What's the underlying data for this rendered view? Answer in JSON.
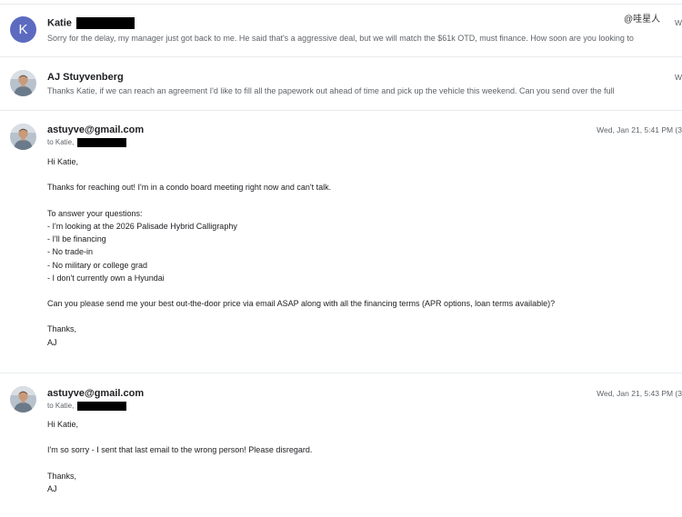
{
  "watermark": "@哇星人",
  "messages": [
    {
      "sender": "Katie",
      "avatar_letter": "K",
      "snippet": "Sorry for the delay, my manager just got back to me. He said that's a aggressive deal, but we will match the $61k OTD, must finance. How soon are you looking to",
      "date": "W"
    },
    {
      "sender": "AJ Stuyvenberg",
      "snippet": "Thanks Katie, if we can reach an agreement I'd like to fill all the papework out ahead of time and pick up the vehicle this weekend. Can you send over the full",
      "date": "W"
    },
    {
      "sender": "astuyve@gmail.com",
      "to": "to Katie,",
      "date": "Wed, Jan 21, 5:41 PM (3",
      "body": [
        "Hi Katie,",
        "",
        "Thanks for reaching out! I'm in a condo board meeting right now and can't talk.",
        "",
        "To answer your questions:",
        "- I'm looking at the 2026 Palisade Hybrid Calligraphy",
        "- I'll be financing",
        "- No trade-in",
        "- No military or college grad",
        "- I don't currently own a Hyundai",
        "",
        "Can you please send me your best out-the-door price via email ASAP along with all the financing terms (APR options, loan terms available)?",
        "",
        "Thanks,",
        "AJ"
      ]
    },
    {
      "sender": "astuyve@gmail.com",
      "to": "to Katie,",
      "date": "Wed, Jan 21, 5:43 PM (3",
      "body": [
        "Hi Katie,",
        "",
        "I'm so sorry - I sent that last email to the wrong person! Please disregard.",
        "",
        "Thanks,",
        "AJ"
      ]
    }
  ]
}
